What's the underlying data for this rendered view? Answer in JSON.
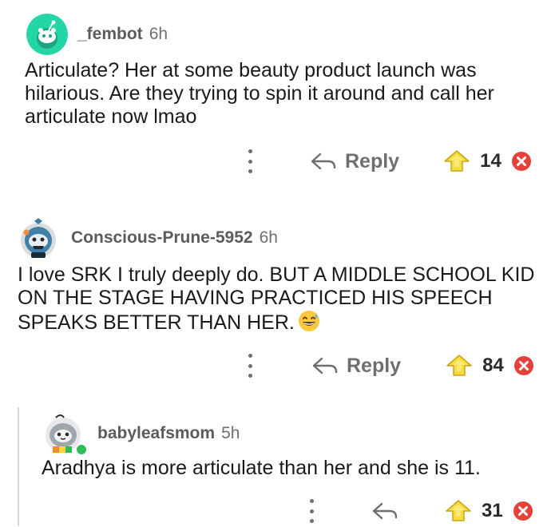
{
  "comments": [
    {
      "username": "_fembot",
      "time": "6h",
      "text": "Articulate? Her at some beauty product launch was hilarious. Are they trying to spin it around and call her articulate now lmao",
      "reply_label": "Reply",
      "score": "14",
      "avatar_color": "#24d6a6"
    },
    {
      "username": "Conscious-Prune-5952",
      "time": "6h",
      "text": "I love SRK I truly deeply do. BUT A MIDDLE SCHOOL KID ON THE STAGE HAVING PRACTICED HIS SPEECH SPEAKS BETTER THAN HER.",
      "emoji": "laughing-sweat-emoji",
      "reply_label": "Reply",
      "score": "84",
      "avatar_color": "#3f7fa8"
    },
    {
      "username": "babyleafsmom",
      "time": "5h",
      "text": "Aradhya is more articulate than her and she is 11.",
      "reply_label": "",
      "score": "31",
      "avatar_color": "#9fa6ad",
      "online": true
    }
  ],
  "colors": {
    "upvote_yellow": "#f5dd3e",
    "downvote_red": "#e5413a",
    "meta_grey": "#6f6f6f",
    "online_green": "#2ebd59"
  }
}
